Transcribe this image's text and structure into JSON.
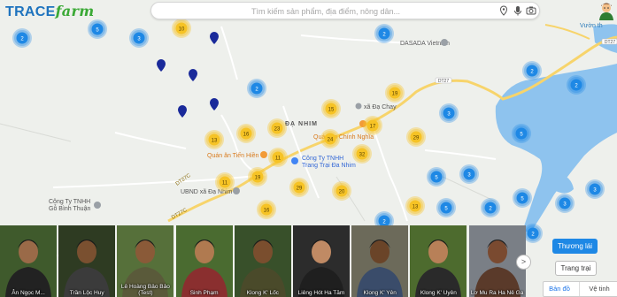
{
  "header": {
    "logo_part1": "TRACE",
    "logo_part2": "farm",
    "search_placeholder": "Tìm kiếm sản phẩm, địa điểm, nông dân...",
    "icons": [
      "location-pin-icon",
      "microphone-icon",
      "camera-icon"
    ],
    "avatar": "farmer-avatar"
  },
  "map": {
    "water_label": "Vườn th",
    "road_label_right": "DT27",
    "poi": [
      {
        "name": "DASADA Vietnam",
        "icon": "pin-icon"
      },
      {
        "name": "xã Đạ Chay",
        "icon": "pin-icon"
      },
      {
        "name": "Quán ăn Chính Nghĩa",
        "icon": "restaurant-icon"
      },
      {
        "name": "Quán ăn Tiến Hiền",
        "icon": "restaurant-icon"
      },
      {
        "name": "Công Ty TNHH\nTrang Trại Đa Nhim",
        "icon": "pin-icon"
      },
      {
        "name": "UBND xã Đạ Nhim",
        "icon": "pin-icon"
      },
      {
        "name": "Công Ty TNHH\nGỗ Bình Thuận",
        "icon": "pin-icon"
      }
    ],
    "area_label": "ĐẠ NHIM",
    "road_label_left": "DT27C",
    "road_label_mid": "DT27C",
    "clusters_yellow": [
      "10",
      "19",
      "15",
      "17",
      "23",
      "24",
      "29",
      "16",
      "13",
      "11",
      "32",
      "19",
      "29",
      "20",
      "11",
      "16",
      "13"
    ],
    "clusters_blue": [
      "2",
      "5",
      "3",
      "2",
      "2",
      "2",
      "2",
      "3",
      "5",
      "5",
      "3",
      "5",
      "2",
      "5",
      "3",
      "3",
      "2",
      "2"
    ]
  },
  "people": [
    {
      "name": "Ân Ngọc M..."
    },
    {
      "name": "Trần Lộc Huy"
    },
    {
      "name": "Lê Hoàng Bảo Bảo (Test)"
    },
    {
      "name": "Sinh Phạm"
    },
    {
      "name": "Klong K' Lốc"
    },
    {
      "name": "Liêng Hót Ha Tăm"
    },
    {
      "name": "Klong K' Yên"
    },
    {
      "name": "Klong K' Uyên"
    },
    {
      "name": "Lơ Mu Ra Ha Nê Ga"
    }
  ],
  "controls": {
    "next_label": ">",
    "btn_thuonglai": "Thương lái",
    "btn_trangtrai": "Trang trại",
    "map_toggle_map": "Bản đồ",
    "map_toggle_sat": "Vệ tinh"
  },
  "colors": {
    "brand_blue": "#1e73be",
    "brand_green": "#3aa935",
    "cluster_yellow": "#f6c325",
    "cluster_blue": "#1e88e5",
    "water": "#8ec3ee",
    "road": "#f7d46b",
    "pin_dark": "#1a2a9a"
  }
}
